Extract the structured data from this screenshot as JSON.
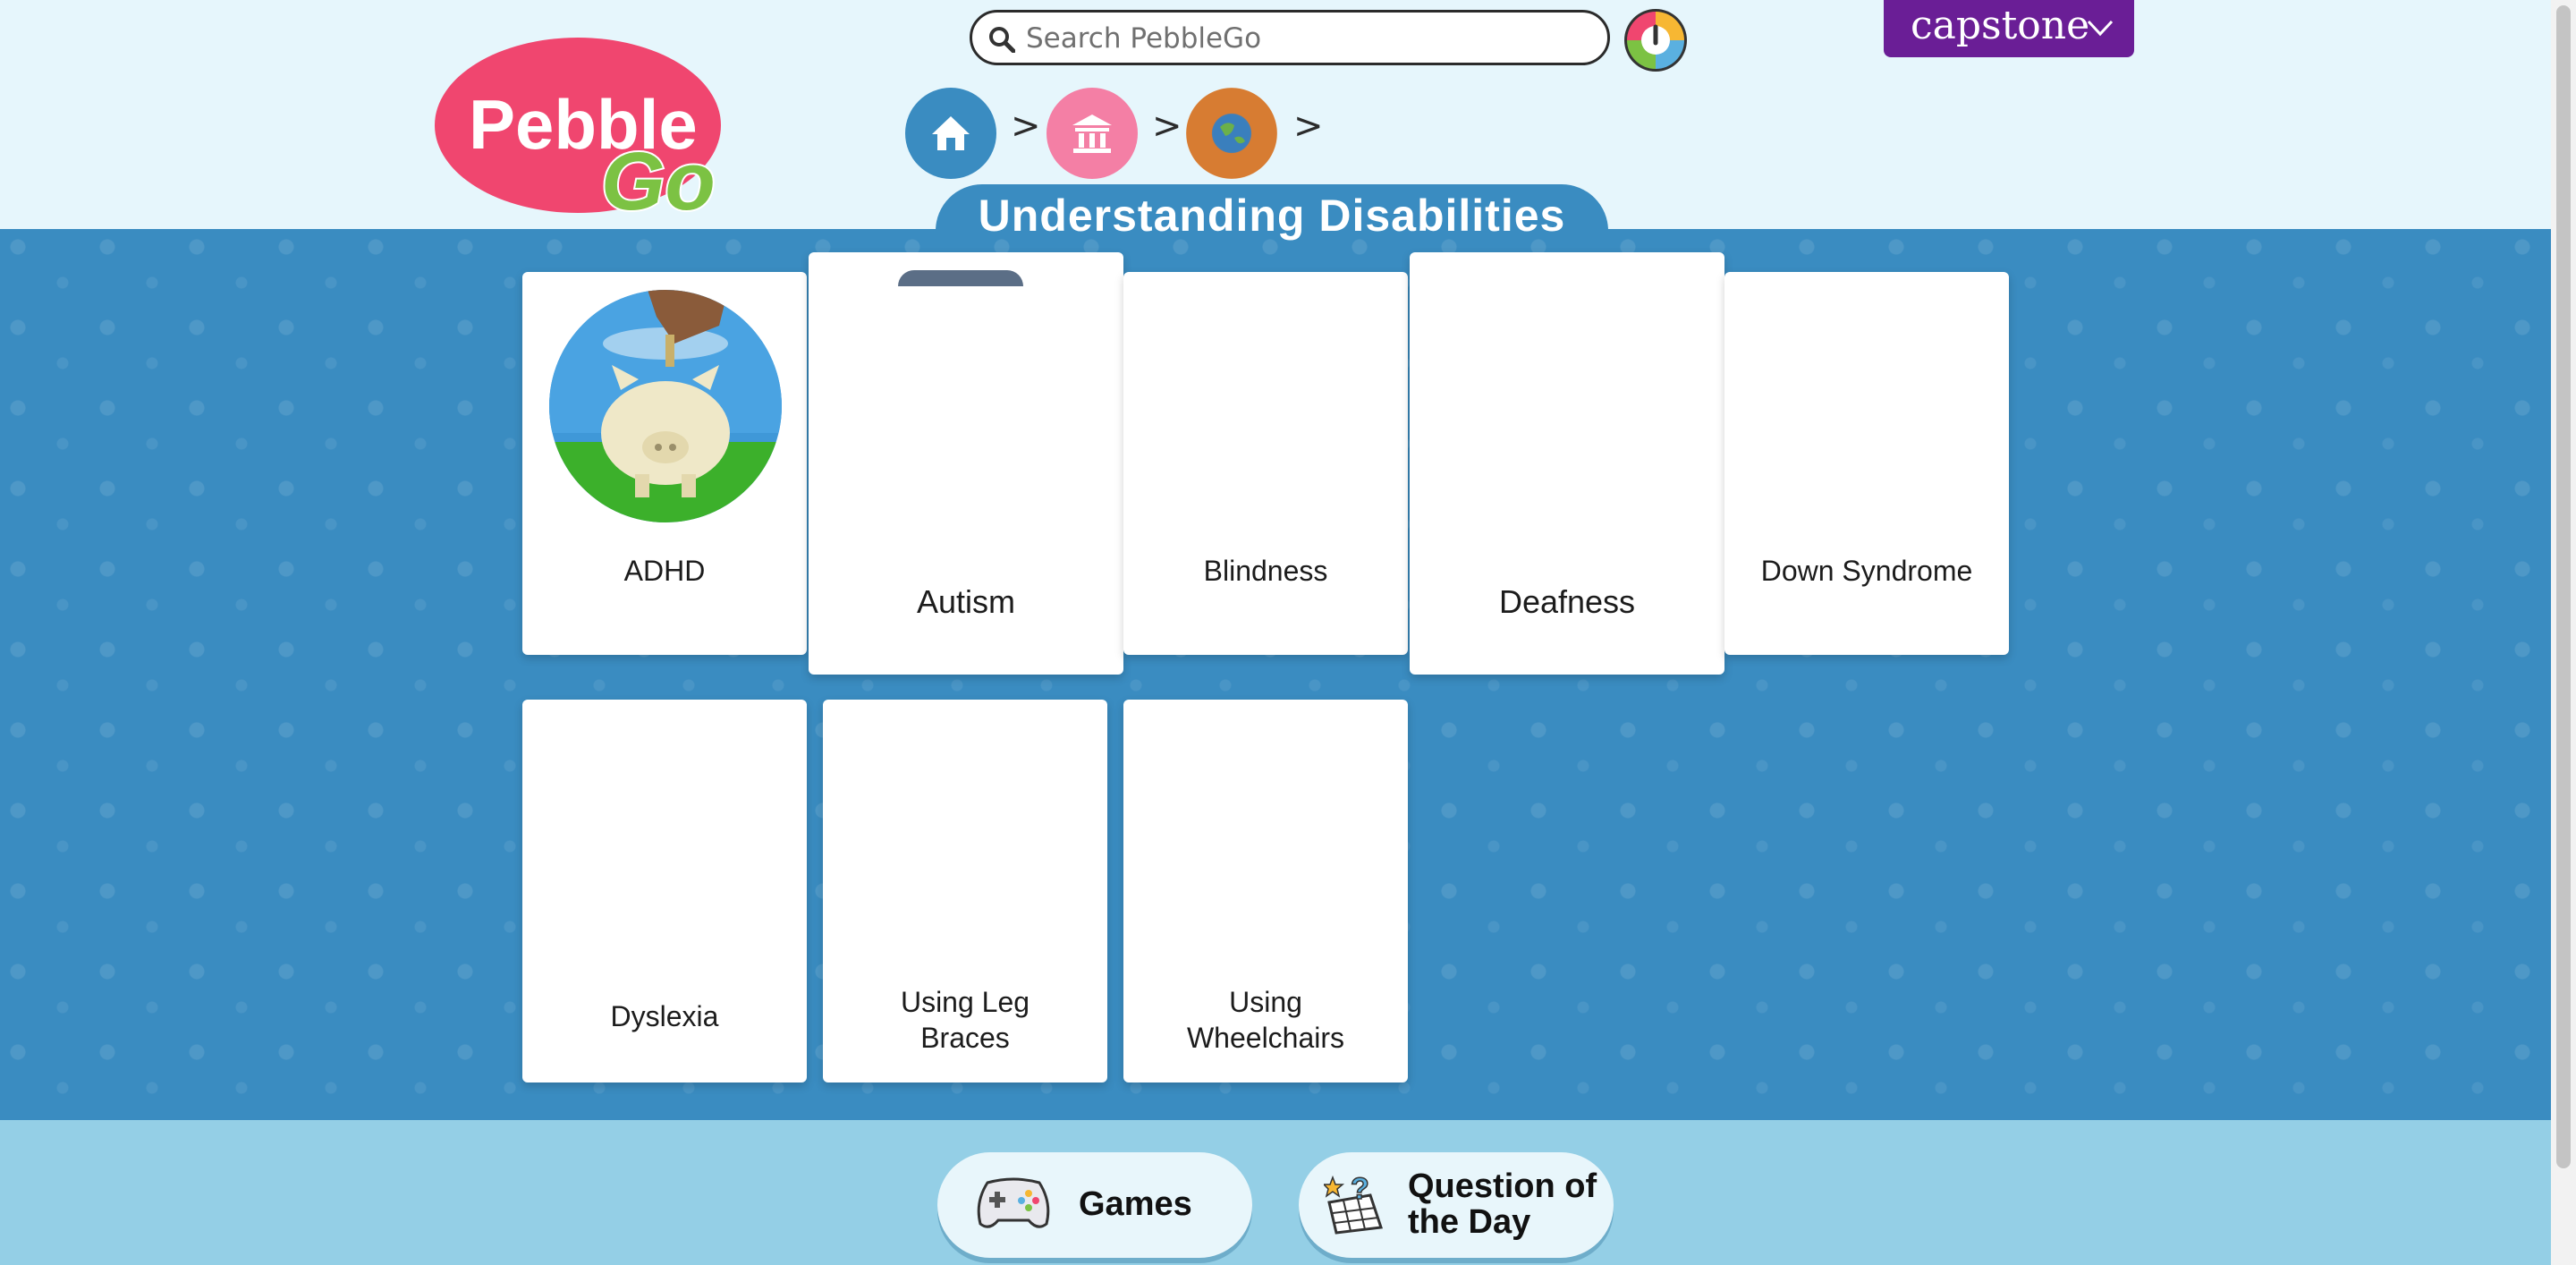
{
  "header": {
    "logo": {
      "word1": "Pebble",
      "word2": "Go"
    },
    "search": {
      "placeholder": "Search PebbleGo"
    },
    "brand_button": {
      "label": "capstone"
    },
    "breadcrumb": [
      "home-icon",
      "museum-icon",
      "globe-icon"
    ]
  },
  "page": {
    "title": "Understanding Disabilities"
  },
  "cards": [
    {
      "label": "ADHD",
      "image": "piggy-bank-photo"
    },
    {
      "label": "Autism"
    },
    {
      "label": "Blindness"
    },
    {
      "label": "Deafness"
    },
    {
      "label": "Down Syndrome"
    },
    {
      "label": "Dyslexia"
    },
    {
      "label": "Using Leg Braces"
    },
    {
      "label": "Using Wheelchairs"
    }
  ],
  "footer": {
    "games": {
      "label": "Games",
      "icon": "gamepad-icon"
    },
    "question": {
      "label_line1": "Question of",
      "label_line2": "the Day",
      "icon": "question-board-icon"
    }
  },
  "colors": {
    "header_bg": "#e6f6fc",
    "main_blue": "#3a8cc1",
    "capstone_purple": "#6a1e96",
    "logo_pink": "#f0466f",
    "logo_green": "#7cc243",
    "footer_bg": "#94cfe6"
  }
}
